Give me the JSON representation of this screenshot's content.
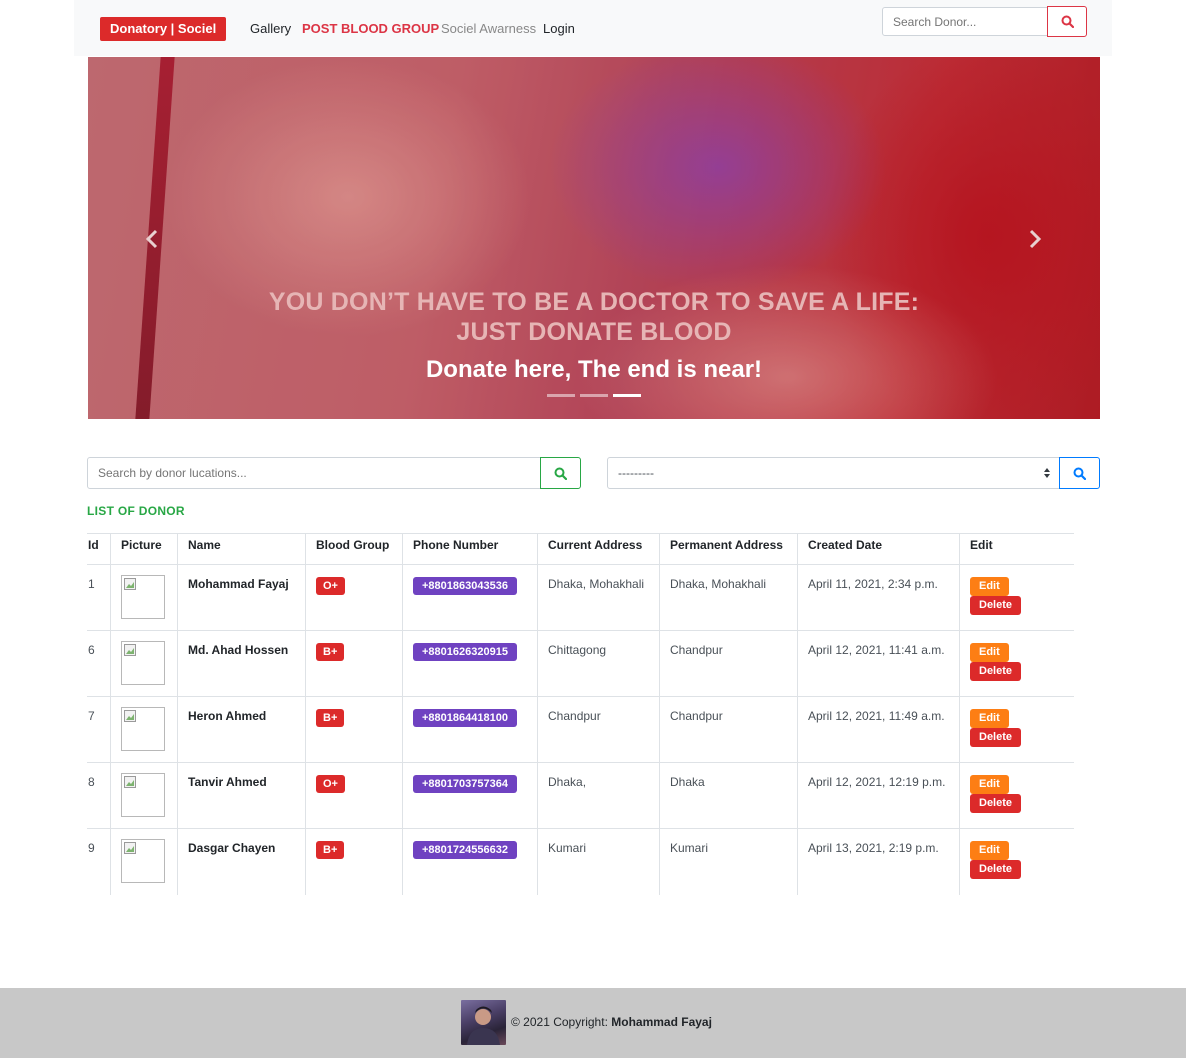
{
  "navbar": {
    "brand": "Donatory | Sociel",
    "links": [
      "Gallery",
      "POST BLOOD GROUP",
      "Sociel Awarness",
      "Login"
    ],
    "search_placeholder": "Search Donor..."
  },
  "hero": {
    "title": "YOU DON’T HAVE TO BE A DOCTOR TO SAVE A LIFE: JUST DONATE BLOOD",
    "subtitle": "Donate here, The end is near!",
    "active_slide": 3,
    "slide_count": 3
  },
  "filters": {
    "location_placeholder": "Search by donor lucations...",
    "blood_group_selected": "---------"
  },
  "list": {
    "title": "LIST OF DONOR",
    "headers": [
      "Id",
      "Picture",
      "Name",
      "Blood Group",
      "Phone Number",
      "Current Address",
      "Permanent Address",
      "Created Date",
      "Edit"
    ],
    "edit_label": "Edit",
    "delete_label": "Delete",
    "rows": [
      {
        "id": "1",
        "name": "Mohammad Fayaj",
        "blood": "O+",
        "phone": "+8801863043536",
        "current": "Dhaka, Mohakhali",
        "permanent": "Dhaka, Mohakhali",
        "created": "April 11, 2021, 2:34 p.m."
      },
      {
        "id": "6",
        "name": "Md. Ahad Hossen",
        "blood": "B+",
        "phone": "+8801626320915",
        "current": "Chittagong",
        "permanent": "Chandpur",
        "created": "April 12, 2021, 11:41 a.m."
      },
      {
        "id": "7",
        "name": "Heron Ahmed",
        "blood": "B+",
        "phone": "+8801864418100",
        "current": "Chandpur",
        "permanent": "Chandpur",
        "created": "April 12, 2021, 11:49 a.m."
      },
      {
        "id": "8",
        "name": "Tanvir Ahmed",
        "blood": "O+",
        "phone": "+8801703757364",
        "current": "Dhaka,",
        "permanent": "Dhaka",
        "created": "April 12, 2021, 12:19 p.m."
      },
      {
        "id": "9",
        "name": "Dasgar Chayen",
        "blood": "B+",
        "phone": "+8801724556632",
        "current": "Kumari",
        "permanent": "Kumari",
        "created": "April 13, 2021, 2:19 p.m."
      }
    ]
  },
  "footer": {
    "copyright": "© 2021 Copyright:",
    "author": "Mohammad Fayaj"
  },
  "colors": {
    "brand": "#dc2a2a",
    "nav_active": "#dc3545",
    "list_title": "#28a745",
    "phone_badge": "#6f42c1",
    "edit_button": "#fd7e14"
  }
}
